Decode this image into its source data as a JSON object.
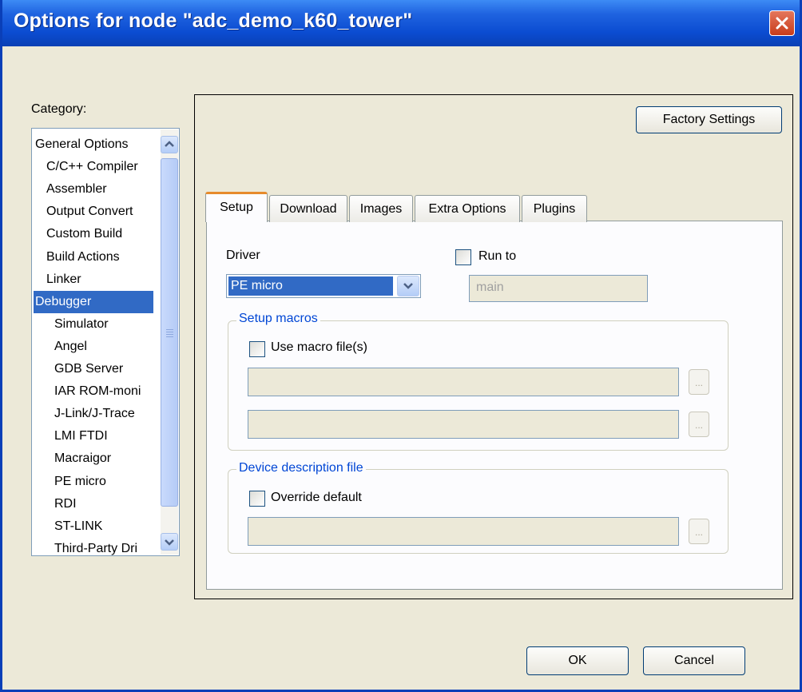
{
  "window": {
    "title": "Options for node \"adc_demo_k60_tower\""
  },
  "category": {
    "label": "Category:",
    "items": [
      {
        "label": "General Options",
        "indent": 0
      },
      {
        "label": "C/C++ Compiler",
        "indent": 1
      },
      {
        "label": "Assembler",
        "indent": 1
      },
      {
        "label": "Output Convert",
        "indent": 1
      },
      {
        "label": "Custom Build",
        "indent": 1
      },
      {
        "label": "Build Actions",
        "indent": 1
      },
      {
        "label": "Linker",
        "indent": 1
      },
      {
        "label": "Debugger",
        "indent": 0,
        "selected": true
      },
      {
        "label": "Simulator",
        "indent": 2
      },
      {
        "label": "Angel",
        "indent": 2
      },
      {
        "label": "GDB Server",
        "indent": 2
      },
      {
        "label": "IAR ROM-moni",
        "indent": 2
      },
      {
        "label": "J-Link/J-Trace",
        "indent": 2
      },
      {
        "label": "LMI FTDI",
        "indent": 2
      },
      {
        "label": "Macraigor",
        "indent": 2
      },
      {
        "label": "PE micro",
        "indent": 2
      },
      {
        "label": "RDI",
        "indent": 2
      },
      {
        "label": "ST-LINK",
        "indent": 2
      },
      {
        "label": "Third-Party Dri",
        "indent": 2
      }
    ]
  },
  "factory_settings_label": "Factory Settings",
  "tabs": [
    {
      "label": "Setup",
      "active": true
    },
    {
      "label": "Download"
    },
    {
      "label": "Images"
    },
    {
      "label": "Extra Options"
    },
    {
      "label": "Plugins"
    }
  ],
  "setup": {
    "driver_label": "Driver",
    "driver_value": "PE micro",
    "run_to_label": "Run to",
    "run_to_checked": false,
    "run_to_value": "main",
    "setup_macros_title": "Setup macros",
    "use_macro_label": "Use macro file(s)",
    "use_macro_checked": false,
    "macro_file_1": "",
    "macro_file_2": "",
    "browse_label": "...",
    "device_desc_title": "Device description file",
    "override_label": "Override default",
    "override_checked": false,
    "device_file": ""
  },
  "buttons": {
    "ok": "OK",
    "cancel": "Cancel"
  },
  "icons": {
    "close": "close-icon",
    "scroll_up": "chevron-up-icon",
    "scroll_down": "chevron-down-icon",
    "dropdown": "chevron-down-icon"
  },
  "colors": {
    "titlebar": "#0b4cd1",
    "selection": "#316ac5",
    "dialog_bg": "#ece9d8",
    "active_tab": "#e68b2c",
    "group_title": "#0046d5"
  }
}
